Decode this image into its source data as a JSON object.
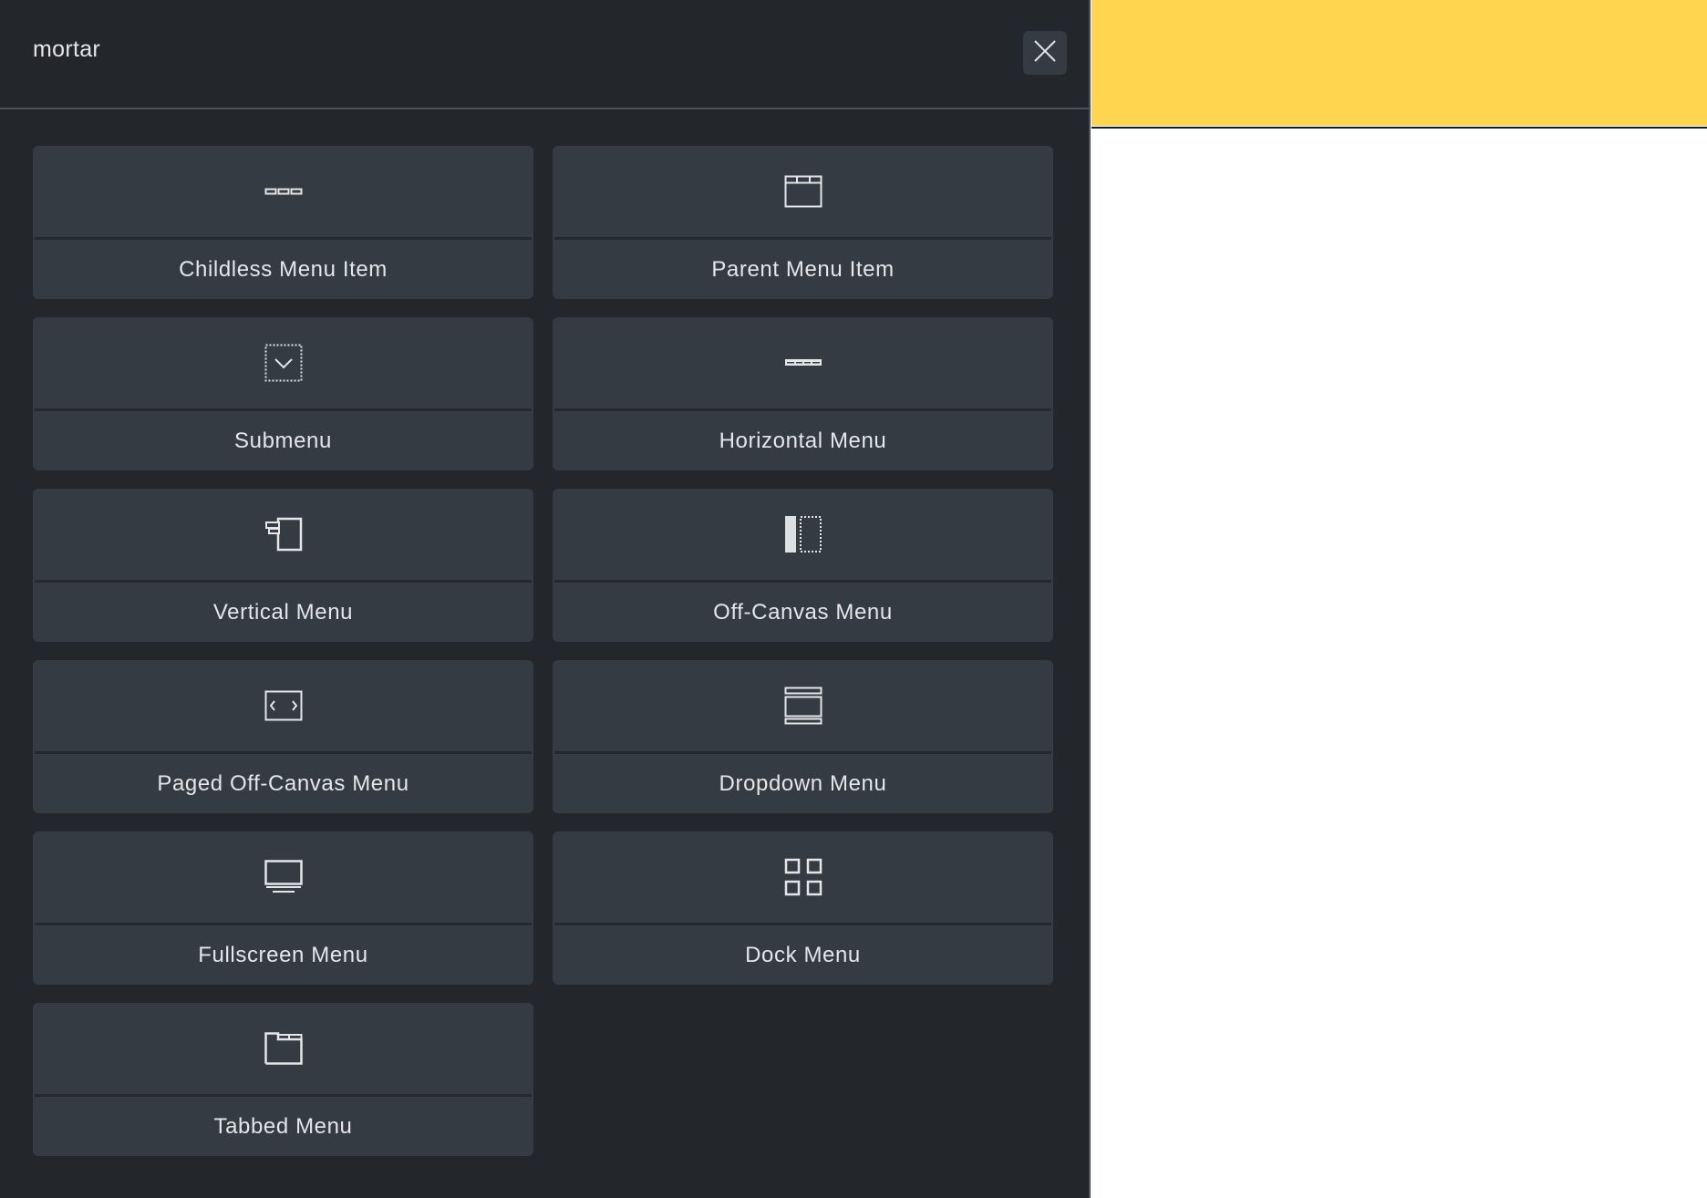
{
  "panel": {
    "title": "mortar",
    "close_icon": "close-icon"
  },
  "elements": [
    {
      "label": "Childless Menu Item",
      "icon": "childless-menu-item-icon"
    },
    {
      "label": "Parent Menu Item",
      "icon": "parent-menu-item-icon"
    },
    {
      "label": "Submenu",
      "icon": "submenu-icon"
    },
    {
      "label": "Horizontal Menu",
      "icon": "horizontal-menu-icon"
    },
    {
      "label": "Vertical Menu",
      "icon": "vertical-menu-icon"
    },
    {
      "label": "Off-Canvas Menu",
      "icon": "off-canvas-menu-icon"
    },
    {
      "label": "Paged Off-Canvas Menu",
      "icon": "paged-off-canvas-menu-icon"
    },
    {
      "label": "Dropdown Menu",
      "icon": "dropdown-menu-icon"
    },
    {
      "label": "Fullscreen Menu",
      "icon": "fullscreen-menu-icon"
    },
    {
      "label": "Dock Menu",
      "icon": "dock-menu-icon"
    },
    {
      "label": "Tabbed Menu",
      "icon": "tabbed-menu-icon"
    }
  ],
  "colors": {
    "panel_bg": "#23272b",
    "card_bg": "#343b43",
    "text": "#e4e6e8",
    "accent_yellow": "#ffd54f"
  }
}
